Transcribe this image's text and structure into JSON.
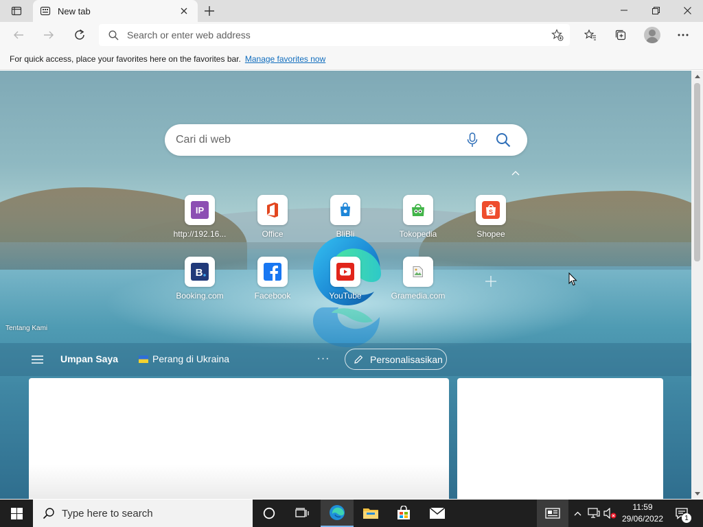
{
  "browser": {
    "tab": {
      "title": "New tab"
    },
    "address": {
      "placeholder": "Search or enter web address"
    },
    "favorites_bar": {
      "message": "For quick access, place your favorites here on the favorites bar.",
      "link": "Manage favorites now"
    }
  },
  "page": {
    "search": {
      "placeholder": "Cari di web"
    },
    "tiles_row1": [
      {
        "label": "http://192.16...",
        "icon": "ip-icon"
      },
      {
        "label": "Office",
        "icon": "office-icon"
      },
      {
        "label": "BliBli",
        "icon": "blibli-icon"
      },
      {
        "label": "Tokopedia",
        "icon": "tokopedia-icon"
      },
      {
        "label": "Shopee",
        "icon": "shopee-icon"
      }
    ],
    "tiles_row2": [
      {
        "label": "Booking.com",
        "icon": "booking-icon"
      },
      {
        "label": "Facebook",
        "icon": "facebook-icon"
      },
      {
        "label": "YouTube",
        "icon": "youtube-icon"
      },
      {
        "label": "Gramedia.com",
        "icon": "broken-image-icon"
      }
    ],
    "about_link": "Tentang Kami",
    "feed": {
      "tab_my_feed": "Umpan Saya",
      "tab_ukraine": "Perang di Ukraina",
      "more": "···",
      "personalize": "Personalisasikan"
    }
  },
  "taskbar": {
    "search_placeholder": "Type here to search",
    "time": "11:59",
    "date": "29/06/2022",
    "notification_count": "1"
  },
  "colors": {
    "accent": "#0f6cbd",
    "taskbar": "#1f1f1f",
    "tab_bar": "#dfdfdf",
    "toolbar": "#f7f7f7"
  }
}
